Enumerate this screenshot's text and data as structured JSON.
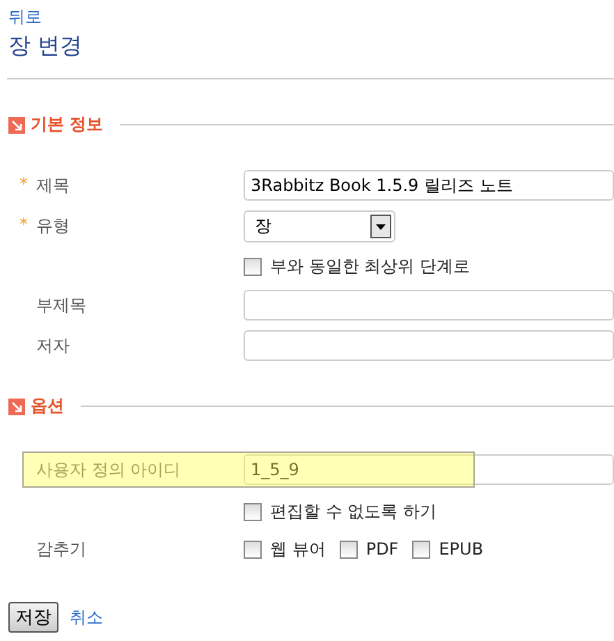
{
  "required_mark": "*",
  "back_link": "뒤로",
  "title": "장 변경",
  "sections": [
    {
      "title": "기본 정보",
      "rows": [
        {
          "kind": "text",
          "label": "제목",
          "required": true,
          "value": "3Rabbitz Book 1.5.9 릴리즈 노트"
        },
        {
          "kind": "select",
          "label": "유형",
          "required": true,
          "value": "장"
        },
        {
          "kind": "checkbox",
          "label": "부와 동일한 최상위 단계로",
          "checked": false
        },
        {
          "kind": "text",
          "label": "부제목",
          "required": false
        },
        {
          "kind": "text",
          "label": "저자",
          "required": false
        }
      ]
    },
    {
      "title": "옵션",
      "rows": [
        {
          "kind": "text",
          "label": "사용자 정의 아이디",
          "required": false,
          "value": "1_5_9",
          "highlighted": true
        },
        {
          "kind": "checkbox",
          "label": "편집할 수 없도록 하기",
          "checked": false
        },
        {
          "kind": "checkgroup",
          "label": "감추기",
          "required": false,
          "options": [
            {
              "label": "웹 뷰어",
              "checked": false
            },
            {
              "label": "PDF",
              "checked": false
            },
            {
              "label": "EPUB",
              "checked": false
            }
          ]
        }
      ]
    }
  ],
  "buttons": {
    "save": "저장",
    "cancel": "취소"
  }
}
